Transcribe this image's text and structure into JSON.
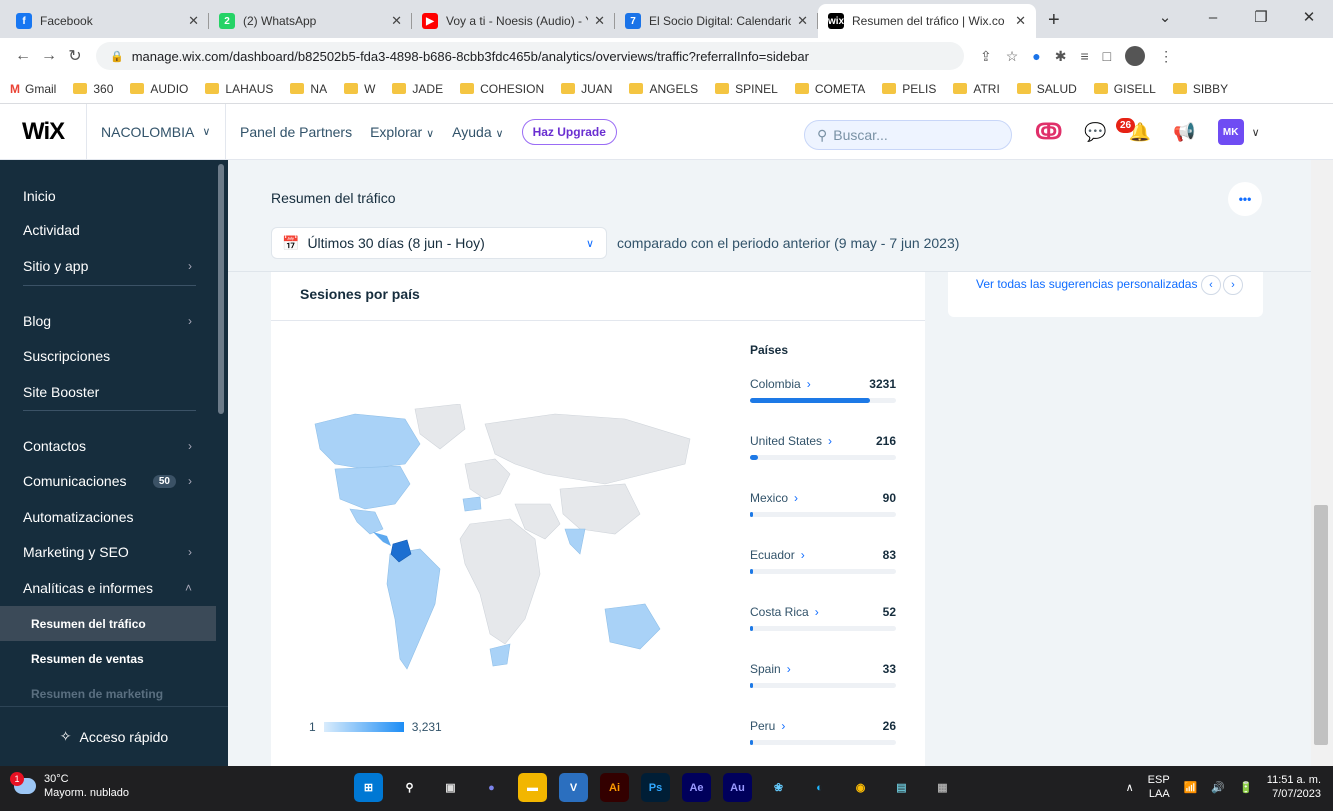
{
  "browser": {
    "tabs": [
      {
        "title": "Facebook",
        "color": "#1877f2",
        "glyph": "f"
      },
      {
        "title": "(2) WhatsApp",
        "color": "#25d366",
        "glyph": "2"
      },
      {
        "title": "Voy a ti - Noesis (Audio) - Yo",
        "color": "#ff0000",
        "glyph": "▶"
      },
      {
        "title": "El Socio Digital: Calendario -",
        "color": "#1a73e8",
        "glyph": "7"
      },
      {
        "title": "Resumen del tráfico | Wix.co",
        "color": "#000000",
        "glyph": "wix"
      }
    ],
    "url": "manage.wix.com/dashboard/b82502b5-fda3-4898-b686-8cbb3fdc465b/analytics/overviews/traffic?referralInfo=sidebar",
    "bookmarks": [
      "Gmail",
      "360",
      "AUDIO",
      "LAHAUS",
      "NA",
      "W",
      "JADE",
      "COHESION",
      "JUAN",
      "ANGELS",
      "SPINEL",
      "COMETA",
      "PELIS",
      "ATRI",
      "SALUD",
      "GISELL",
      "SIBBY"
    ]
  },
  "topbar": {
    "logo": "WiX",
    "site_name": "NACOLOMBIA",
    "partners": "Panel de Partners",
    "explore": "Explorar",
    "help": "Ayuda",
    "upgrade": "Haz Upgrade",
    "search_placeholder": "Buscar...",
    "notif_count": "26",
    "avatar": "MK"
  },
  "sidebar": {
    "items": [
      {
        "label": "Inicio",
        "chevron": ""
      },
      {
        "label": "Actividad",
        "chevron": ""
      },
      {
        "label": "Sitio y app",
        "chevron": "›"
      },
      {
        "label": "Blog",
        "chevron": "›"
      },
      {
        "label": "Suscripciones",
        "chevron": ""
      },
      {
        "label": "Site Booster",
        "chevron": ""
      },
      {
        "label": "Contactos",
        "chevron": "›"
      },
      {
        "label": "Comunicaciones",
        "chevron": "›",
        "badge": "50"
      },
      {
        "label": "Automatizaciones",
        "chevron": ""
      },
      {
        "label": "Marketing y SEO",
        "chevron": "›"
      },
      {
        "label": "Analíticas e informes",
        "chevron": "˄"
      }
    ],
    "subitems": [
      "Resumen del tráfico",
      "Resumen de ventas",
      "Resumen de marketing"
    ],
    "quick_access": "Acceso rápido"
  },
  "page": {
    "title": "Resumen del tráfico",
    "date_range": "Últimos 30 días (8 jun - Hoy)",
    "comparison": "comparado con el periodo anterior (9 may - 7 jun 2023)",
    "suggestions_link": "Ver todas las sugerencias personalizadas"
  },
  "sessions_card": {
    "title": "Sesiones por país",
    "list_header": "Países",
    "legend_min": "1",
    "legend_max": "3,231",
    "countries": [
      {
        "name": "Colombia",
        "value": "3231",
        "share": 0.825
      },
      {
        "name": "United States",
        "value": "216",
        "share": 0.055
      },
      {
        "name": "Mexico",
        "value": "90",
        "share": 0.023
      },
      {
        "name": "Ecuador",
        "value": "83",
        "share": 0.021
      },
      {
        "name": "Costa Rica",
        "value": "52",
        "share": 0.013
      },
      {
        "name": "Spain",
        "value": "33",
        "share": 0.008
      },
      {
        "name": "Peru",
        "value": "26",
        "share": 0.007
      }
    ]
  },
  "taskbar": {
    "temp": "30°C",
    "weather": "Mayorm. nublado",
    "weather_badge": "1",
    "lang": "ESP",
    "lang2": "LAA",
    "time": "11:51 a. m.",
    "date": "7/07/2023"
  },
  "colors": {
    "accent": "#116dff",
    "sidebar": "#162d3d"
  }
}
